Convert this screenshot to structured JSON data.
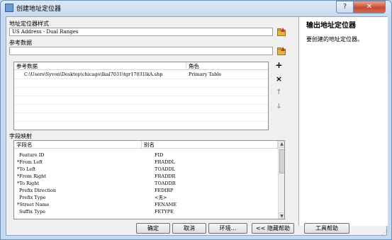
{
  "window": {
    "title": "创建地址定位器"
  },
  "titlebar": {
    "help_glyph": "?",
    "close_glyph": "✕"
  },
  "fields": {
    "style_label": "地址定位器样式",
    "style_value": "US Address - Dual Ranges",
    "reference_label": "参考数据",
    "reference_value": ""
  },
  "ref_table": {
    "headers": [
      "参考数据",
      "角色"
    ],
    "rows": [
      {
        "data": "C:\\Users\\Syvon\\Desktop\\chicago\\lkal7031\\tgr17031lkA.shp",
        "role": "Primary Table"
      }
    ]
  },
  "side_buttons": {
    "add": "+",
    "remove": "×",
    "up": "↑",
    "down": "↓"
  },
  "mapping": {
    "section_label": "字段映射",
    "headers": [
      "字段名",
      "别名"
    ],
    "rows": [
      {
        "field": "Feature ID",
        "alias": "FID"
      },
      {
        "field": "*From Left",
        "alias": "FRADDL"
      },
      {
        "field": "*To Left",
        "alias": "TOADDL"
      },
      {
        "field": "*From Right",
        "alias": "FRADDR"
      },
      {
        "field": "*To Right",
        "alias": "TOADDR"
      },
      {
        "field": "Prefix Direction",
        "alias": "FEDIRP"
      },
      {
        "field": "Prefix Type",
        "alias": "<无>"
      },
      {
        "field": "*Street Name",
        "alias": "FENAME"
      },
      {
        "field": "Suffix Type",
        "alias": "FETYPE"
      }
    ]
  },
  "help": {
    "title": "输出地址定位器",
    "body": "要创建的地址定位器。"
  },
  "buttons": {
    "ok": "确定",
    "cancel": "取消",
    "env": "环境...",
    "hide_help": "<< 隐藏帮助",
    "tool_help": "工具帮助"
  },
  "colors": {
    "frame": "#c9d9ec",
    "close": "#c84a32",
    "folder": "#e2b441"
  }
}
